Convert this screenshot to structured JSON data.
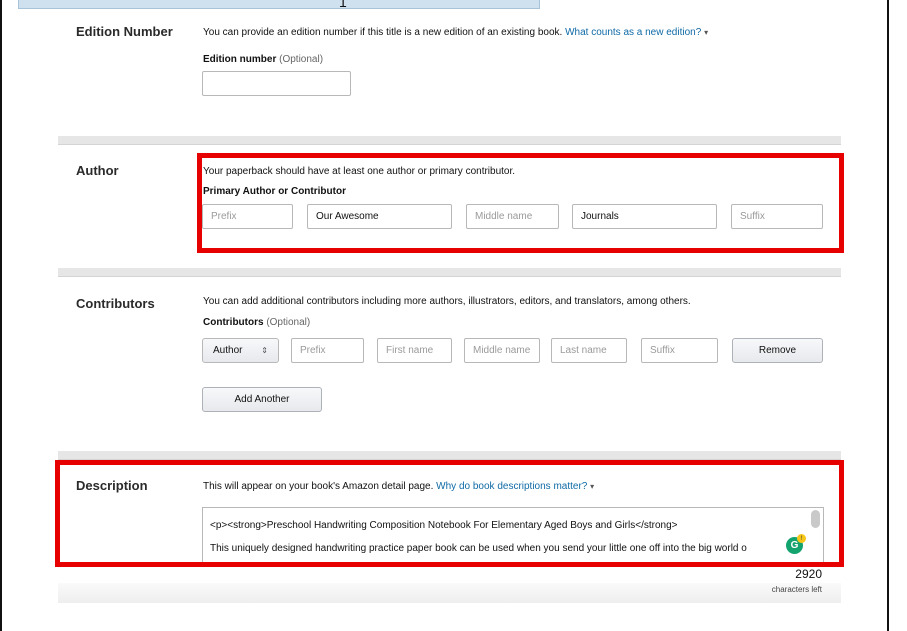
{
  "colors": {
    "accent_link": "#0f6aa6",
    "highlight": "#e60000"
  },
  "top_glyph": "1",
  "edition": {
    "label": "Edition Number",
    "desc": "You can provide an edition number if this title is a new edition of an existing book.",
    "link": "What counts as a new edition?",
    "field_label": "Edition number",
    "optional": "(Optional)",
    "value": ""
  },
  "author": {
    "label": "Author",
    "desc": "Your paperback should have at least one author or primary contributor.",
    "field_label": "Primary Author or Contributor",
    "prefix_placeholder": "Prefix",
    "first_name_value": "Our Awesome",
    "middle_placeholder": "Middle name",
    "last_name_value": "Journals",
    "suffix_placeholder": "Suffix"
  },
  "contributors": {
    "label": "Contributors",
    "desc": "You can add additional contributors including more authors, illustrators, editors, and translators, among others.",
    "field_label": "Contributors",
    "optional": "(Optional)",
    "role_selected": "Author",
    "prefix_placeholder": "Prefix",
    "first_placeholder": "First name",
    "middle_placeholder": "Middle name",
    "last_placeholder": "Last name",
    "suffix_placeholder": "Suffix",
    "remove_label": "Remove",
    "add_label": "Add Another"
  },
  "description": {
    "label": "Description",
    "desc": "This will appear on your book's Amazon detail page.",
    "link": "Why do book descriptions matter?",
    "line1": "<p><strong>Preschool Handwriting Composition Notebook For Elementary Aged Boys and Girls</strong>",
    "line2": "This uniquely designed handwriting practice paper book can be used when you send your little one off into the big world o",
    "chars_left": "2920",
    "chars_left_label": "characters left"
  }
}
